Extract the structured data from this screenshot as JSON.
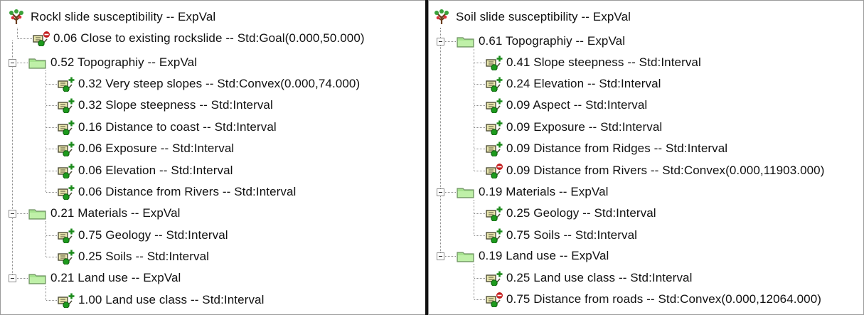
{
  "left_tree": {
    "root": {
      "label": "Rockl slide susceptibility -- ExpVal",
      "icon": "tree-root-icon"
    },
    "items": [
      {
        "label": "0.06 Close to existing rockslide -- Std:Goal(0.000,50.000)",
        "icon": "criterion-minus-icon"
      },
      {
        "label": "0.52 Topographiy -- ExpVal",
        "icon": "folder-icon"
      },
      {
        "label": "0.32 Very steep slopes -- Std:Convex(0.000,74.000)",
        "icon": "criterion-plus-icon"
      },
      {
        "label": "0.32 Slope steepness -- Std:Interval",
        "icon": "criterion-plus-icon"
      },
      {
        "label": "0.16 Distance to coast -- Std:Interval",
        "icon": "criterion-plus-icon"
      },
      {
        "label": "0.06 Exposure -- Std:Interval",
        "icon": "criterion-plus-icon"
      },
      {
        "label": "0.06 Elevation -- Std:Interval",
        "icon": "criterion-plus-icon"
      },
      {
        "label": "0.06 Distance from Rivers -- Std:Interval",
        "icon": "criterion-plus-icon"
      },
      {
        "label": "0.21 Materials -- ExpVal",
        "icon": "folder-icon"
      },
      {
        "label": "0.75 Geology -- Std:Interval",
        "icon": "criterion-plus-icon"
      },
      {
        "label": "0.25 Soils -- Std:Interval",
        "icon": "criterion-plus-icon"
      },
      {
        "label": "0.21 Land use -- ExpVal",
        "icon": "folder-icon"
      },
      {
        "label": "1.00 Land use class -- Std:Interval",
        "icon": "criterion-plus-icon"
      }
    ]
  },
  "right_tree": {
    "root": {
      "label": "Soil slide susceptibility -- ExpVal",
      "icon": "tree-root-icon"
    },
    "items": [
      {
        "label": "0.61 Topographiy -- ExpVal",
        "icon": "folder-icon"
      },
      {
        "label": "0.41 Slope steepness -- Std:Interval",
        "icon": "criterion-plus-icon"
      },
      {
        "label": "0.24 Elevation -- Std:Interval",
        "icon": "criterion-plus-icon"
      },
      {
        "label": "0.09 Aspect -- Std:Interval",
        "icon": "criterion-plus-icon"
      },
      {
        "label": "0.09 Exposure -- Std:Interval",
        "icon": "criterion-plus-icon"
      },
      {
        "label": "0.09 Distance from Ridges -- Std:Interval",
        "icon": "criterion-plus-icon"
      },
      {
        "label": "0.09 Distance from Rivers -- Std:Convex(0.000,11903.000)",
        "icon": "criterion-minus-icon"
      },
      {
        "label": "0.19 Materials -- ExpVal",
        "icon": "folder-icon"
      },
      {
        "label": "0.25 Geology -- Std:Interval",
        "icon": "criterion-plus-icon"
      },
      {
        "label": "0.75 Soils -- Std:Interval",
        "icon": "criterion-plus-icon"
      },
      {
        "label": "0.19 Land use -- ExpVal",
        "icon": "folder-icon"
      },
      {
        "label": "0.25 Land use class -- Std:Interval",
        "icon": "criterion-plus-icon"
      },
      {
        "label": "0.75 Distance from roads -- Std:Convex(0.000,12064.000)",
        "icon": "criterion-minus-icon"
      }
    ]
  },
  "colors": {
    "folder": "#a6e38f",
    "criterion_plus_badge": "#1a8a1a",
    "criterion_minus_badge": "#c41e1e",
    "root_icon": "#6b3d1e"
  }
}
